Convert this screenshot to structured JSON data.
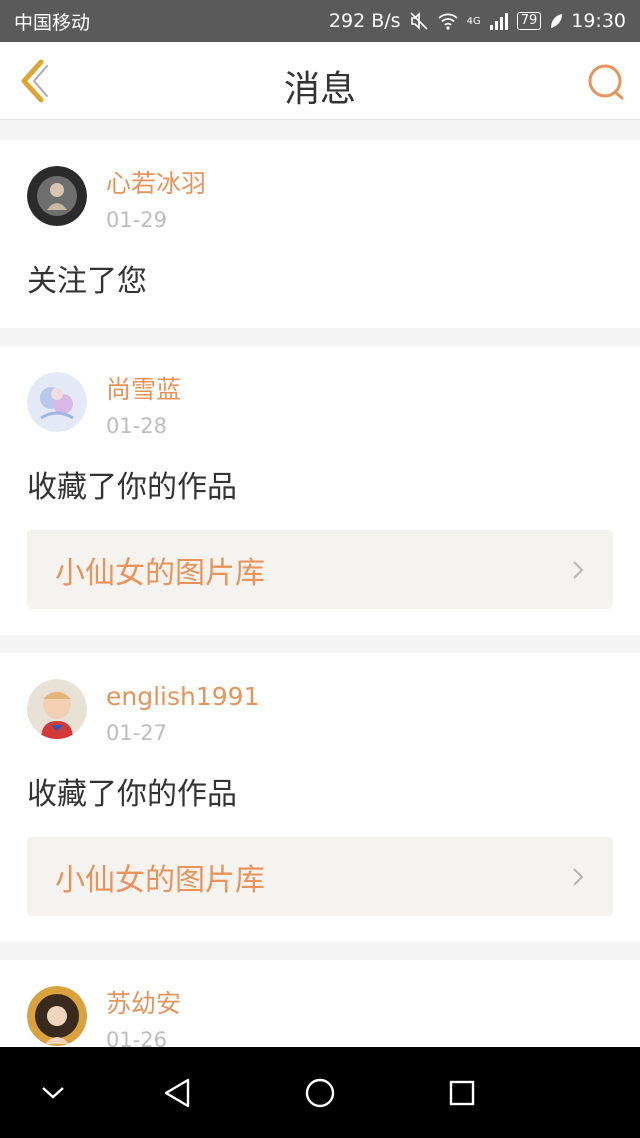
{
  "status": {
    "carrier": "中国移动",
    "speed": "292 B/s",
    "network": "4G",
    "battery": "79",
    "time": "19:30"
  },
  "header": {
    "title": "消息"
  },
  "messages": [
    {
      "user": "心若冰羽",
      "date": "01-29",
      "action": "关注了您",
      "work": ""
    },
    {
      "user": "尚雪蓝",
      "date": "01-28",
      "action": "收藏了你的作品",
      "work": "小仙女的图片库"
    },
    {
      "user": "english1991",
      "date": "01-27",
      "action": "收藏了你的作品",
      "work": "小仙女的图片库"
    },
    {
      "user": "苏幼安",
      "date": "01-26",
      "action": "",
      "work": ""
    }
  ],
  "colors": {
    "accent": "#e8935a",
    "status_bar": "#5a5a5a",
    "muted": "#bdbdbd"
  }
}
